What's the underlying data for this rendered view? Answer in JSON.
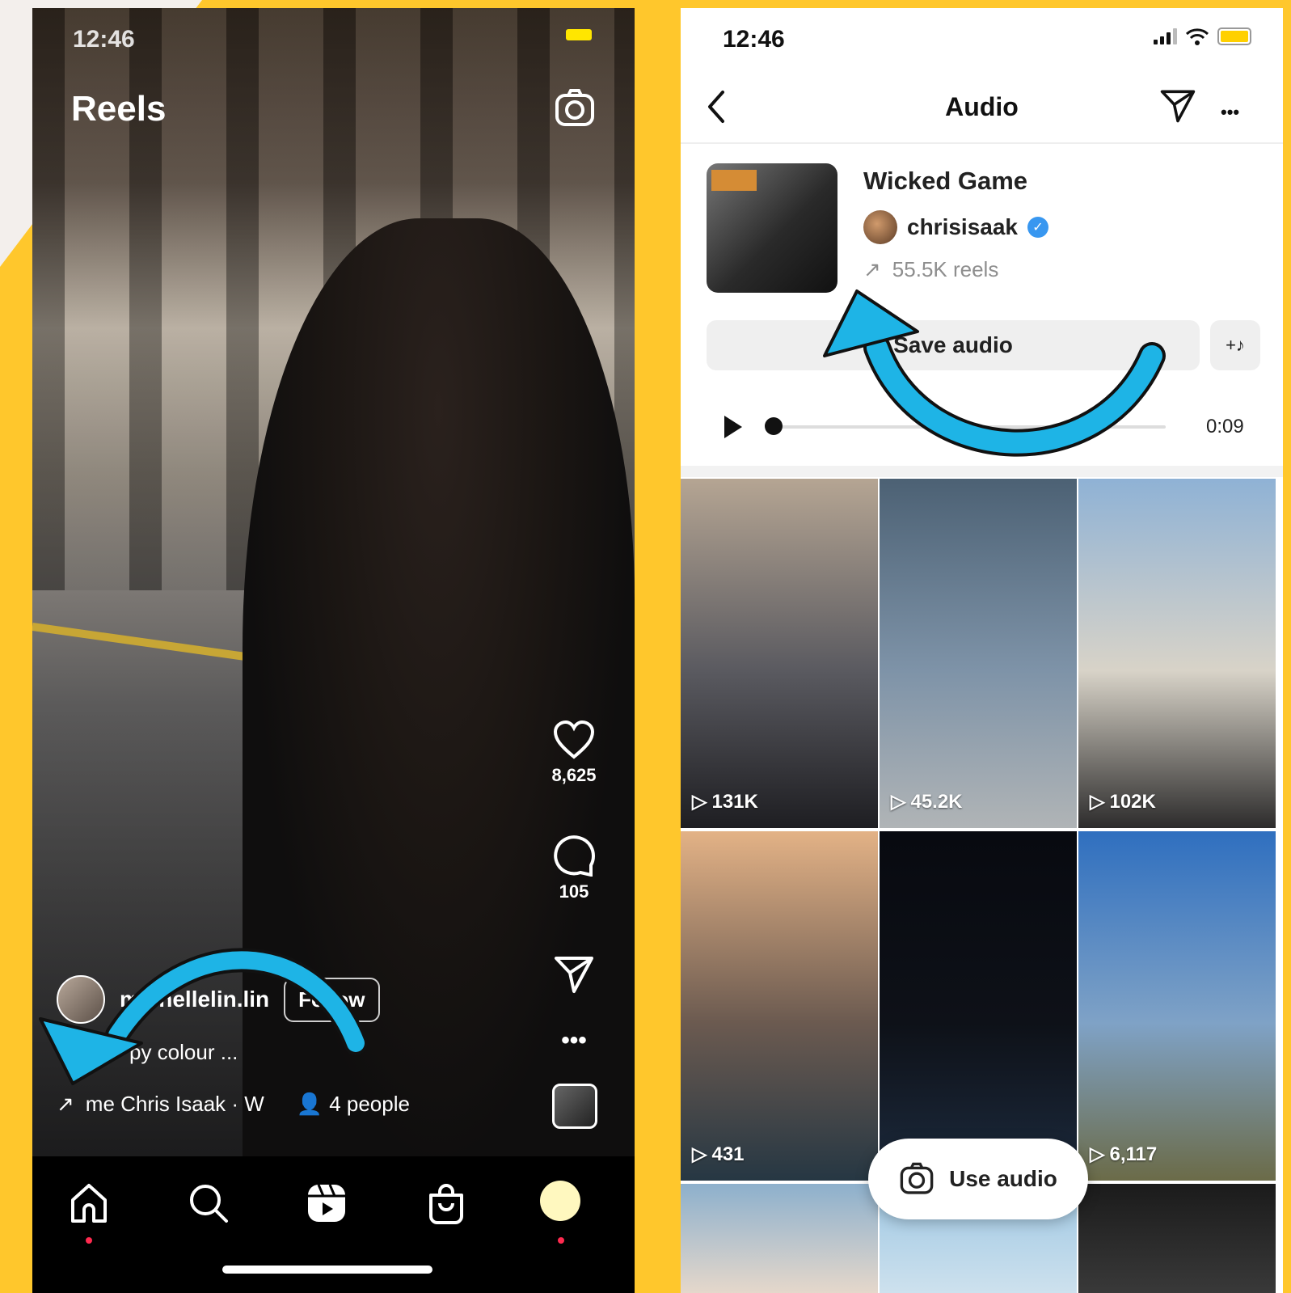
{
  "left_phone": {
    "status_time": "12:46",
    "title": "Reels",
    "actions": {
      "likes": "8,625",
      "comments": "105"
    },
    "username": "michellelin.lin",
    "follow_label": "Follow",
    "caption": "py colour ...",
    "audio_text": "me  Chris Isaak · W",
    "people": "4 people"
  },
  "right_phone": {
    "status_time": "12:46",
    "header_title": "Audio",
    "track_title": "Wicked Game",
    "artist": "chrisisaak",
    "reels_count": "55.5K reels",
    "save_audio_label": "Save audio",
    "duration": "0:09",
    "use_audio_label": "Use audio",
    "grid": [
      {
        "views": "131K",
        "colors": [
          "#b5a593",
          "#5a5a60",
          "#1e1e22"
        ]
      },
      {
        "views": "45.2K",
        "colors": [
          "#4c6174",
          "#7e93a8",
          "#b0b4b6"
        ]
      },
      {
        "views": "102K",
        "colors": [
          "#8fb2d5",
          "#d8d3c8",
          "#2d2c2c"
        ]
      },
      {
        "views": "431",
        "colors": [
          "#e3b286",
          "#6b5a50",
          "#263743"
        ]
      },
      {
        "views": "",
        "colors": [
          "#080a10",
          "#0e1118",
          "#1c2a3d"
        ]
      },
      {
        "views": "6,117",
        "colors": [
          "#2f6fbf",
          "#7fa2c6",
          "#6b6b48"
        ]
      }
    ]
  },
  "colors": {
    "background": "#FFC72C",
    "annotation_arrow": "#1EB4E6",
    "verified": "#3897F0"
  }
}
